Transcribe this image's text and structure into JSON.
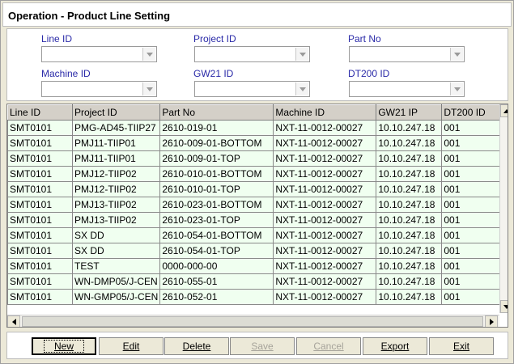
{
  "window": {
    "title": "Operation - Product Line Setting"
  },
  "filters": {
    "line_id": {
      "label": "Line ID",
      "value": ""
    },
    "project_id": {
      "label": "Project ID",
      "value": ""
    },
    "part_no": {
      "label": "Part No",
      "value": ""
    },
    "machine_id": {
      "label": "Machine ID",
      "value": ""
    },
    "gw21_id": {
      "label": "GW21 ID",
      "value": ""
    },
    "dt200_id": {
      "label": "DT200 ID",
      "value": ""
    }
  },
  "grid": {
    "columns": [
      "Line ID",
      "Project ID",
      "Part No",
      "Machine ID",
      "GW21 IP",
      "DT200 ID"
    ],
    "rows": [
      [
        "SMT0101",
        "PMG-AD45-TIIP27",
        "2610-019-01",
        "NXT-11-0012-00027",
        "10.10.247.18",
        "001"
      ],
      [
        "SMT0101",
        "PMJ11-TIIP01",
        "2610-009-01-BOTTOM",
        "NXT-11-0012-00027",
        "10.10.247.18",
        "001"
      ],
      [
        "SMT0101",
        "PMJ11-TIIP01",
        "2610-009-01-TOP",
        "NXT-11-0012-00027",
        "10.10.247.18",
        "001"
      ],
      [
        "SMT0101",
        "PMJ12-TIIP02",
        "2610-010-01-BOTTOM",
        "NXT-11-0012-00027",
        "10.10.247.18",
        "001"
      ],
      [
        "SMT0101",
        "PMJ12-TIIP02",
        "2610-010-01-TOP",
        "NXT-11-0012-00027",
        "10.10.247.18",
        "001"
      ],
      [
        "SMT0101",
        "PMJ13-TIIP02",
        "2610-023-01-BOTTOM",
        "NXT-11-0012-00027",
        "10.10.247.18",
        "001"
      ],
      [
        "SMT0101",
        "PMJ13-TIIP02",
        "2610-023-01-TOP",
        "NXT-11-0012-00027",
        "10.10.247.18",
        "001"
      ],
      [
        "SMT0101",
        "SX DD",
        "2610-054-01-BOTTOM",
        "NXT-11-0012-00027",
        "10.10.247.18",
        "001"
      ],
      [
        "SMT0101",
        "SX DD",
        "2610-054-01-TOP",
        "NXT-11-0012-00027",
        "10.10.247.18",
        "001"
      ],
      [
        "SMT0101",
        "TEST",
        "0000-000-00",
        "NXT-11-0012-00027",
        "10.10.247.18",
        "001"
      ],
      [
        "SMT0101",
        "WN-DMP05/J-CEN",
        "2610-055-01",
        "NXT-11-0012-00027",
        "10.10.247.18",
        "001"
      ],
      [
        "SMT0101",
        "WN-GMP05/J-CEN",
        "2610-052-01",
        "NXT-11-0012-00027",
        "10.10.247.18",
        "001"
      ]
    ]
  },
  "icons": {
    "dropdown": "chevron-down-icon",
    "scroll_up": "arrow-up-icon",
    "scroll_down": "arrow-down-icon",
    "scroll_left": "arrow-left-icon",
    "scroll_right": "arrow-right-icon"
  },
  "buttons": {
    "new": "New",
    "edit": "Edit",
    "delete": "Delete",
    "save": "Save",
    "cancel": "Cancel",
    "export": "Export",
    "exit": "Exit"
  }
}
